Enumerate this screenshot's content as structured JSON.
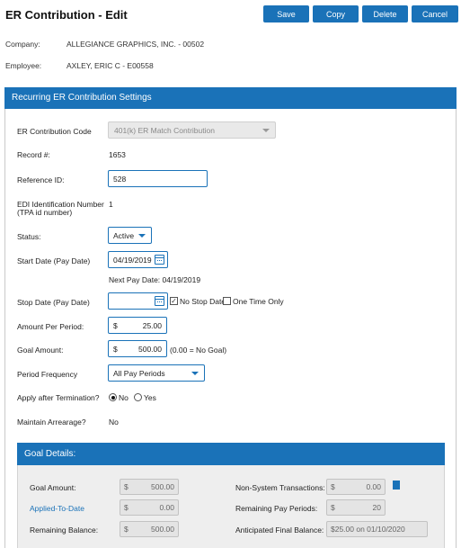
{
  "header": {
    "title": "ER Contribution  - Edit",
    "buttons": {
      "save": "Save",
      "copy": "Copy",
      "delete": "Delete",
      "cancel": "Cancel"
    }
  },
  "info": {
    "company_label": "Company:",
    "company_value": "ALLEGIANCE GRAPHICS, INC. - 00502",
    "employee_label": "Employee:",
    "employee_value": "AXLEY, ERIC C - E00558"
  },
  "settings": {
    "title": "Recurring ER Contribution Settings",
    "contribution_code": {
      "label": "ER Contribution Code",
      "value": "401(k) ER Match Contribution"
    },
    "record": {
      "label": "Record #:",
      "value": "1653"
    },
    "reference": {
      "label": "Reference ID:",
      "value": "528"
    },
    "edi": {
      "label_line1": "EDI Identification Number",
      "label_line2": "(TPA id number)",
      "value": "1"
    },
    "status": {
      "label": "Status:",
      "value": "Active"
    },
    "start_date": {
      "label": "Start Date (Pay Date)",
      "value": "04/19/2019",
      "next_pay": "Next Pay Date: 04/19/2019"
    },
    "stop_date": {
      "label": "Stop Date (Pay Date)",
      "value": "",
      "no_stop_label": "No Stop Date",
      "no_stop_checked": true,
      "one_time_label": "One Time Only",
      "one_time_checked": false
    },
    "amount_per_period": {
      "label": "Amount Per Period:",
      "currency": "$",
      "value": "25.00"
    },
    "goal_amount": {
      "label": "Goal Amount:",
      "currency": "$",
      "value": "500.00",
      "note": "(0.00 = No Goal)"
    },
    "period_frequency": {
      "label": "Period Frequency",
      "value": "All Pay Periods"
    },
    "apply_after_termination": {
      "label": "Apply after Termination?",
      "no_label": "No",
      "yes_label": "Yes",
      "selected": "No"
    },
    "maintain_arrearage": {
      "label": "Maintain Arrearage?",
      "value": "No"
    }
  },
  "goal_details": {
    "title": "Goal Details:",
    "goal_amount": {
      "label": "Goal Amount:",
      "currency": "$",
      "value": "500.00"
    },
    "applied_to_date": {
      "label": "Applied-To-Date",
      "currency": "$",
      "value": "0.00"
    },
    "remaining_balance": {
      "label": "Remaining Balance:",
      "currency": "$",
      "value": "500.00"
    },
    "non_system_transactions": {
      "label": "Non-System Transactions:",
      "currency": "$",
      "value": "0.00"
    },
    "remaining_pay_periods": {
      "label": "Remaining Pay Periods:",
      "currency": "$",
      "value": "20"
    },
    "anticipated_final_balance": {
      "label": "Anticipated Final Balance:",
      "value": "$25.00 on 01/10/2020"
    }
  },
  "colors": {
    "accent": "#1a72b8",
    "link": "#1a72b8"
  }
}
